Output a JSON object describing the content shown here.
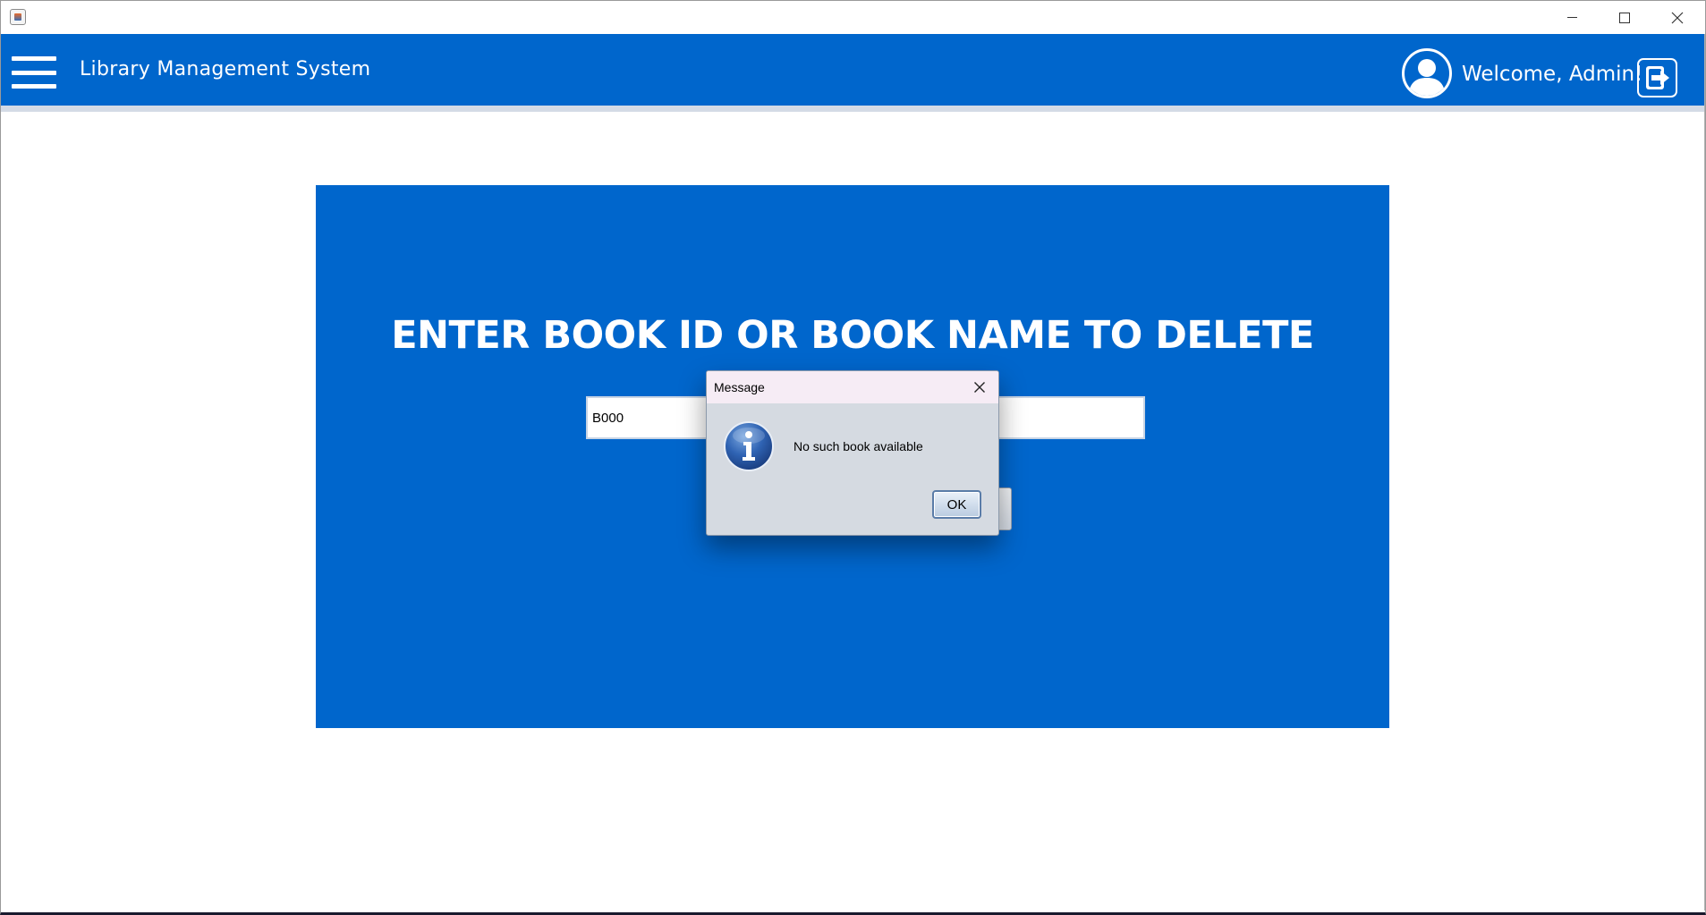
{
  "window": {
    "minimize_label": "—",
    "maximize_label": "□",
    "close_label": "✕",
    "app_icon": "java-icon"
  },
  "header": {
    "menu_icon": "hamburger-icon",
    "title": "Library Management System",
    "avatar_icon": "user-avatar-icon",
    "welcome_text": "Welcome, Admin!",
    "logout_icon": "logout-icon",
    "background_color": "#0066cc"
  },
  "panel": {
    "heading": "ENTER BOOK ID OR BOOK NAME TO DELETE",
    "input_value": "B000",
    "background_color": "#0066cc"
  },
  "dialog": {
    "title": "Message",
    "message": "No such book available",
    "ok_label": "OK",
    "icon": "info-icon",
    "close_icon": "close-icon"
  }
}
